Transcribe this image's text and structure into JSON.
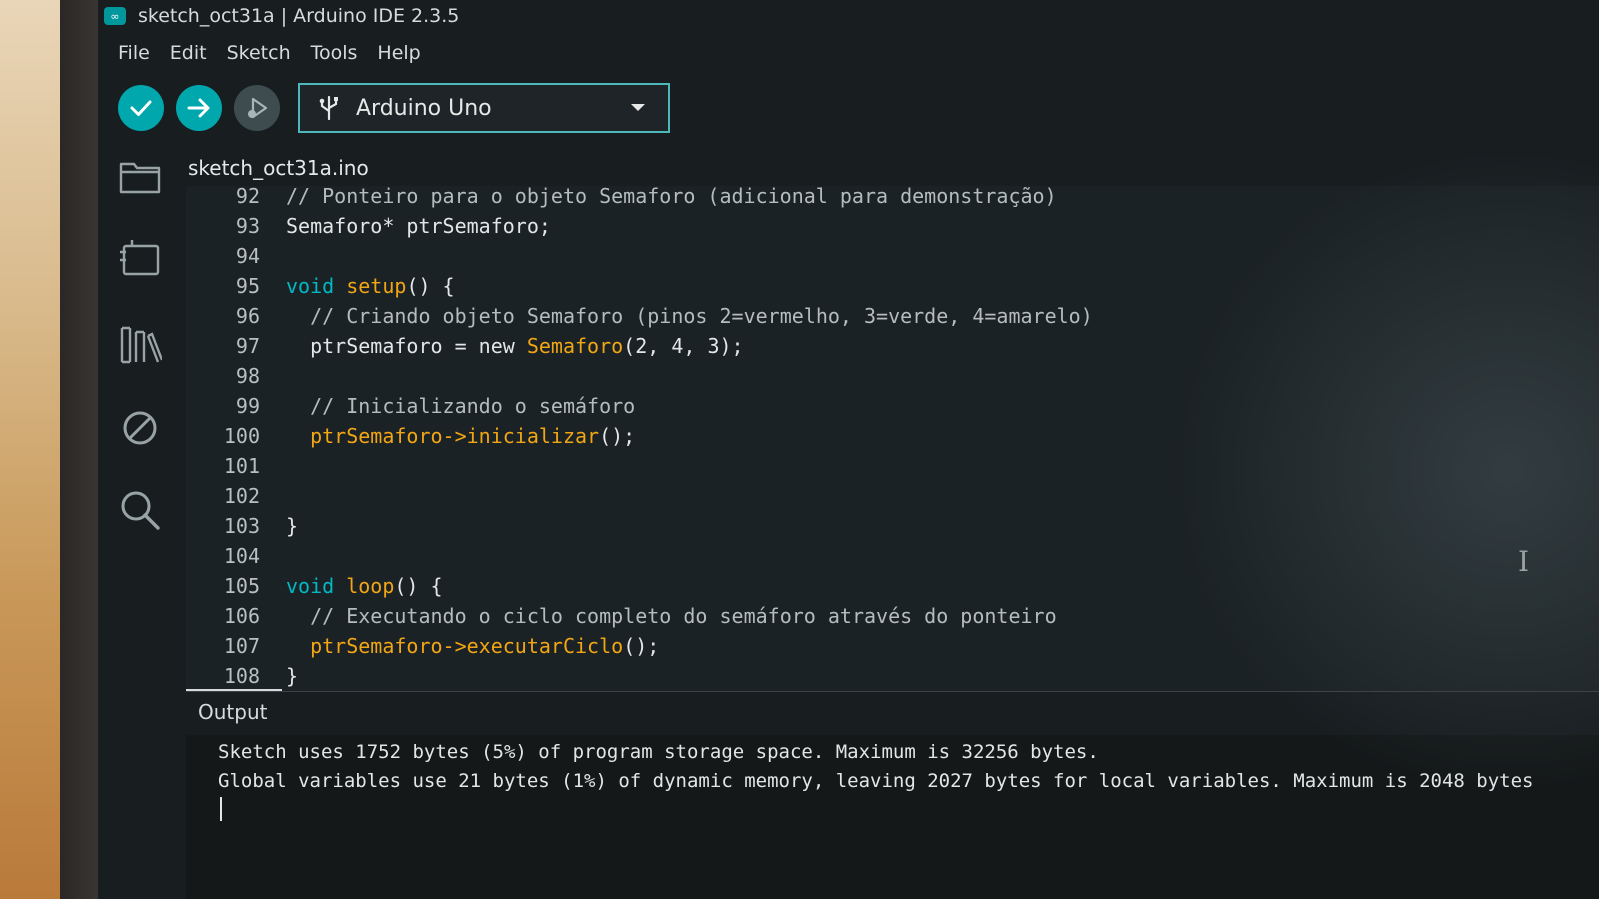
{
  "window": {
    "title": "sketch_oct31a | Arduino IDE 2.3.5",
    "app_icon": "arduino-logo-icon"
  },
  "menu": {
    "items": [
      "File",
      "Edit",
      "Sketch",
      "Tools",
      "Help"
    ]
  },
  "toolbar": {
    "verify": "checkmark-icon",
    "upload": "arrow-right-icon",
    "debug": "debugger-icon",
    "board": "Arduino Uno",
    "accent": "#00a7ad"
  },
  "sidebar": {
    "items": [
      "folder-icon",
      "board-manager-icon",
      "library-manager-icon",
      "debug-disabled-icon",
      "search-icon"
    ]
  },
  "tab": {
    "label": "sketch_oct31a.ino"
  },
  "editor": {
    "lines": [
      {
        "n": "92",
        "indent": "",
        "parts": [
          {
            "t": "// Ponteiro para o objeto Semaforo (adicional para demonstração)",
            "c": "cm"
          }
        ]
      },
      {
        "n": "93",
        "indent": "",
        "parts": [
          {
            "t": "Semaforo* ptrSemaforo;",
            "c": ""
          }
        ]
      },
      {
        "n": "94",
        "indent": "",
        "parts": []
      },
      {
        "n": "95",
        "indent": "",
        "parts": [
          {
            "t": "void",
            "c": "kw"
          },
          {
            "t": " ",
            "c": ""
          },
          {
            "t": "setup",
            "c": "fn"
          },
          {
            "t": "() {",
            "c": ""
          }
        ]
      },
      {
        "n": "96",
        "indent": "  ",
        "parts": [
          {
            "t": "// Criando objeto Semaforo (pinos 2=vermelho, 3=verde, 4=amarelo)",
            "c": "cm"
          }
        ]
      },
      {
        "n": "97",
        "indent": "  ",
        "parts": [
          {
            "t": "ptrSemaforo = new ",
            "c": ""
          },
          {
            "t": "Semaforo",
            "c": "fn"
          },
          {
            "t": "(2, 4, 3);",
            "c": ""
          }
        ]
      },
      {
        "n": "98",
        "indent": "",
        "parts": []
      },
      {
        "n": "99",
        "indent": "  ",
        "parts": [
          {
            "t": "// Inicializando o semáforo",
            "c": "cm"
          }
        ]
      },
      {
        "n": "100",
        "indent": "  ",
        "parts": [
          {
            "t": "ptrSemaforo->",
            "c": "fn"
          },
          {
            "t": "inicializar",
            "c": "fn"
          },
          {
            "t": "();",
            "c": ""
          }
        ]
      },
      {
        "n": "101",
        "indent": "",
        "parts": []
      },
      {
        "n": "102",
        "indent": "",
        "parts": []
      },
      {
        "n": "103",
        "indent": "",
        "parts": [
          {
            "t": "}",
            "c": ""
          }
        ]
      },
      {
        "n": "104",
        "indent": "",
        "parts": []
      },
      {
        "n": "105",
        "indent": "",
        "parts": [
          {
            "t": "void",
            "c": "kw"
          },
          {
            "t": " ",
            "c": ""
          },
          {
            "t": "loop",
            "c": "fn"
          },
          {
            "t": "() {",
            "c": ""
          }
        ]
      },
      {
        "n": "106",
        "indent": "  ",
        "parts": [
          {
            "t": "// Executando o ciclo completo do semáforo através do ponteiro",
            "c": "cm"
          }
        ]
      },
      {
        "n": "107",
        "indent": "  ",
        "parts": [
          {
            "t": "ptrSemaforo->",
            "c": "fn"
          },
          {
            "t": "executarCiclo",
            "c": "fn"
          },
          {
            "t": "();",
            "c": ""
          }
        ]
      },
      {
        "n": "108",
        "indent": "",
        "parts": [
          {
            "t": "}",
            "c": ""
          }
        ]
      }
    ]
  },
  "output": {
    "title": "Output",
    "lines": [
      "Sketch uses 1752 bytes (5%) of program storage space. Maximum is 32256 bytes.",
      "Global variables use 21 bytes (1%) of dynamic memory, leaving 2027 bytes for local variables. Maximum is 2048 bytes"
    ]
  }
}
